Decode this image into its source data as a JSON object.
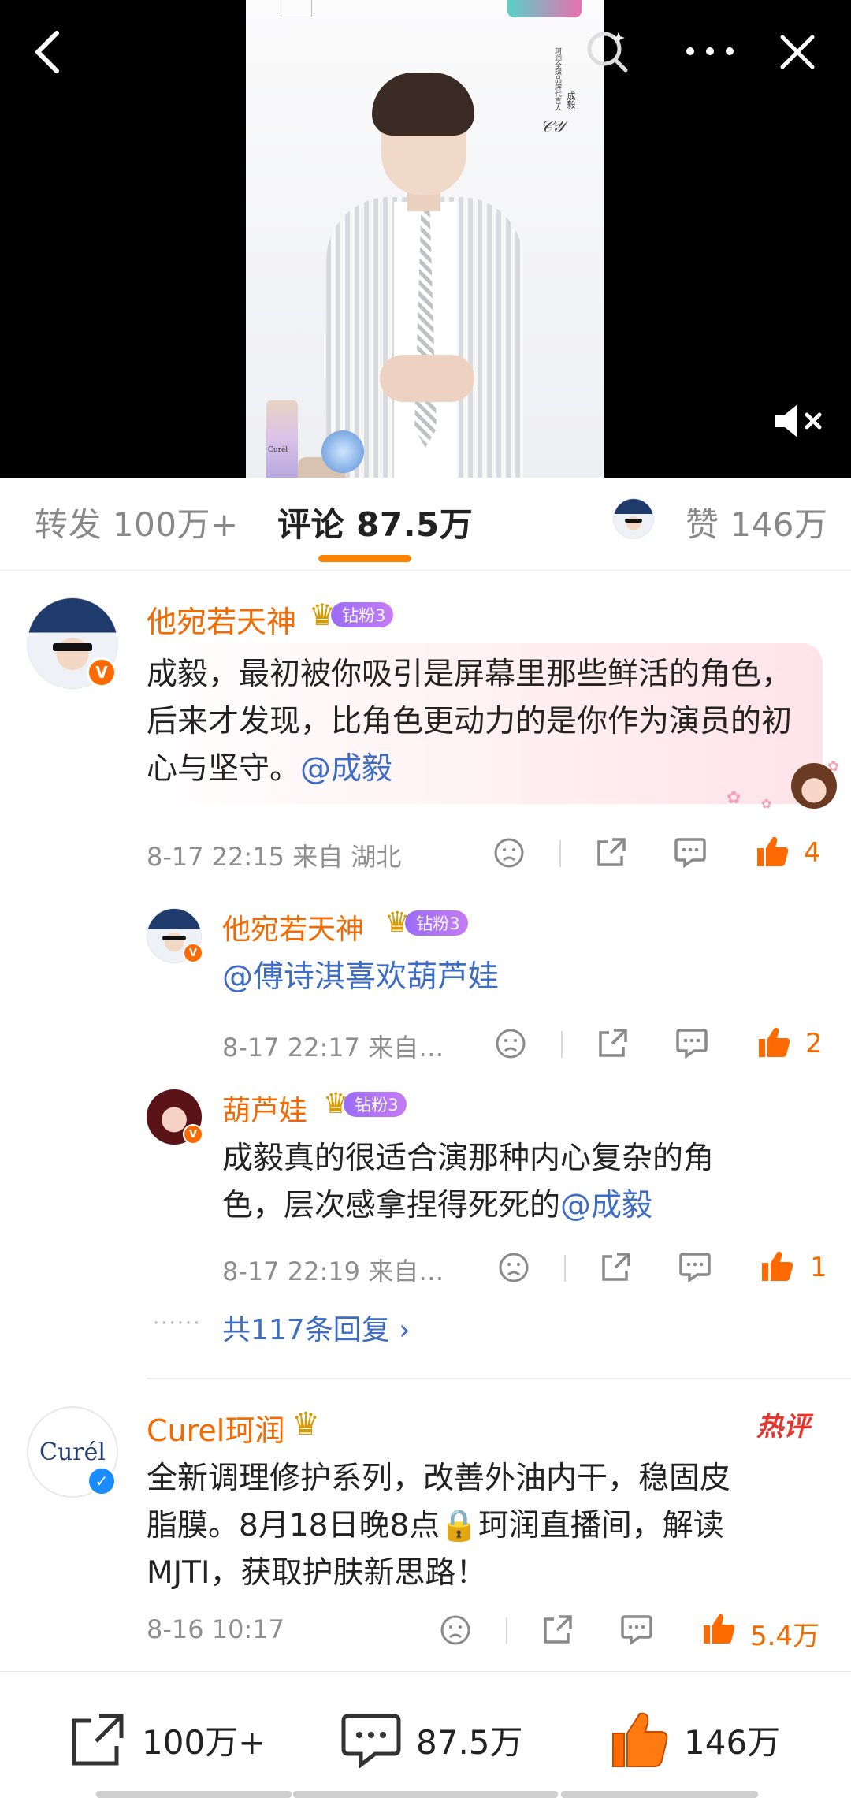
{
  "video": {
    "overlay_vertical_text": "珂润全球品牌代言人",
    "overlay_name": "成毅",
    "product_label": "Curél",
    "icons": [
      "back-icon",
      "search-icon",
      "more-icon",
      "close-icon",
      "mute-icon"
    ]
  },
  "tabs": {
    "repost": "转发 100万+",
    "comments": "评论 87.5万",
    "likes": "赞 146万",
    "accent_color": "#ff8200"
  },
  "comments": [
    {
      "user": "他宛若天神",
      "fan_badge": "钻粉3",
      "text": "成毅，最初被你吸引是屏幕里那些鲜活的角色，后来才发现，比角色更动力的是你作为演员的初心与坚守。",
      "mention": "@成毅",
      "time": "8-17 22:15",
      "location": "来自 湖北",
      "likes": "4",
      "replies": [
        {
          "user": "他宛若天神",
          "fan_badge": "钻粉3",
          "mention": "@傅诗淇喜欢葫芦娃",
          "time": "8-17 22:17",
          "location": "来自…",
          "likes": "2"
        },
        {
          "user": "葫芦娃",
          "fan_badge": "钻粉3",
          "text_line1": "成毅真的很适合演那种内心复杂的角",
          "text_line2": "色，层次感拿捏得死死的",
          "mention": "@成毅",
          "time": "8-17 22:19",
          "location": "来自…",
          "likes": "1"
        }
      ],
      "more_replies": "共117条回复"
    },
    {
      "user": "Curel珂润",
      "hot_tag": "热评",
      "avatar_text": "Curél",
      "text_line1": "全新调理修护系列，改善外油内干，稳固皮",
      "text_line2": "脂膜。8月18日晚8点🔒珂润直播间，解读",
      "text_line3": "MJTI，获取护肤新思路！",
      "time": "8-16 10:17",
      "likes": "5.4万"
    }
  ],
  "bottom_bar": {
    "repost": "100万+",
    "comments": "87.5万",
    "likes": "146万"
  },
  "colors": {
    "username": "#f26a00",
    "mention": "#3e6cc3",
    "like": "#ff6a00",
    "fan_badge": "#a46ff4"
  }
}
